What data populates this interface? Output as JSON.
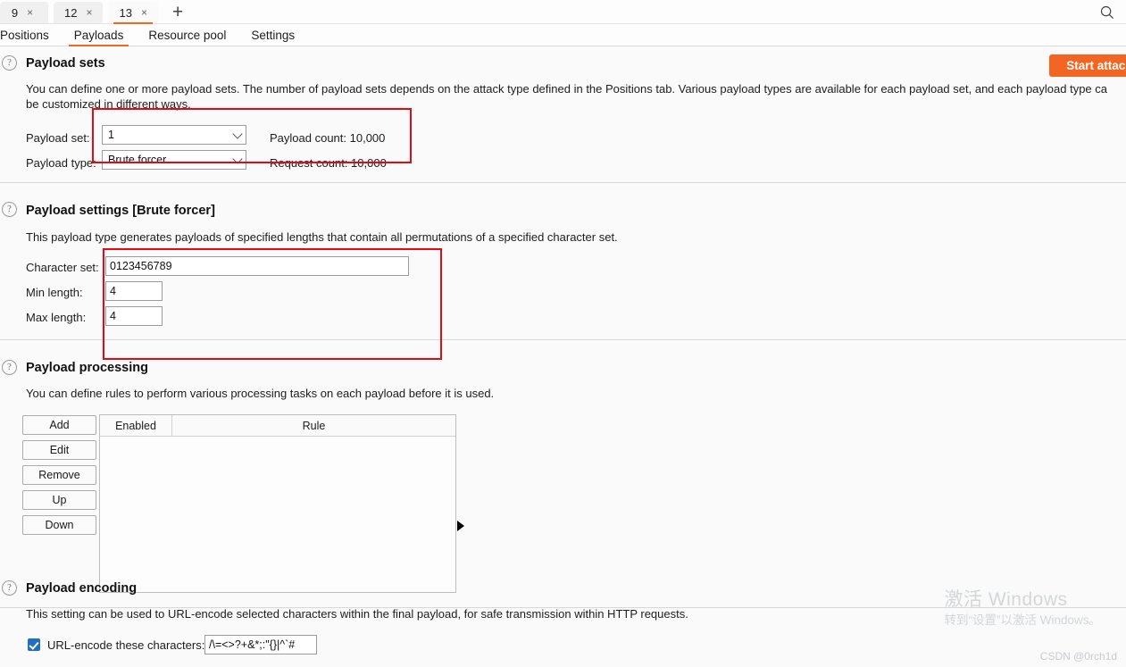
{
  "window": {
    "tabs": [
      {
        "label": "9",
        "close": "×",
        "active": false
      },
      {
        "label": "12",
        "close": "×",
        "active": false
      },
      {
        "label": "13",
        "close": "×",
        "active": true
      }
    ],
    "new_tab_label": "+",
    "search_icon": "search-icon"
  },
  "subnav": {
    "items": [
      {
        "label": "Positions",
        "active": false
      },
      {
        "label": "Payloads",
        "active": true
      },
      {
        "label": "Resource pool",
        "active": false
      },
      {
        "label": "Settings",
        "active": false
      }
    ]
  },
  "toolbar": {
    "start_attack_label": "Start attack",
    "accent_color": "#f26522"
  },
  "payload_sets": {
    "help_icon": "?",
    "title": "Payload sets",
    "description_line1": "You can define one or more payload sets. The number of payload sets depends on the attack type defined in the Positions tab. Various payload types are available for each payload set, and each payload type ca",
    "description_line2": "be customized in different ways.",
    "payload_set_label": "Payload set:",
    "payload_set_value": "1",
    "payload_type_label": "Payload type:",
    "payload_type_value": "Brute forcer",
    "payload_count_label": "Payload count:  10,000",
    "request_count_label": "Request count:  10,000"
  },
  "payload_settings": {
    "help_icon": "?",
    "title": "Payload settings [Brute forcer]",
    "description": "This payload type generates payloads of specified lengths that contain all permutations of a specified character set.",
    "character_set_label": "Character set:",
    "character_set_value": "0123456789",
    "min_length_label": "Min length:",
    "min_length_value": "4",
    "max_length_label": "Max length:",
    "max_length_value": "4"
  },
  "payload_processing": {
    "help_icon": "?",
    "title": "Payload processing",
    "description": "You can define rules to perform various processing tasks on each payload before it is used.",
    "buttons": [
      {
        "label": "Add"
      },
      {
        "label": "Edit"
      },
      {
        "label": "Remove"
      },
      {
        "label": "Up"
      },
      {
        "label": "Down"
      }
    ],
    "table": {
      "columns": [
        "Enabled",
        "Rule"
      ],
      "rows": []
    },
    "expand_icon": "triangle-right-icon"
  },
  "payload_encoding": {
    "help_icon": "?",
    "title": "Payload encoding",
    "description": "This setting can be used to URL-encode selected characters within the final payload, for safe transmission within HTTP requests.",
    "url_encode_checked": true,
    "url_encode_label": "URL-encode these characters:",
    "url_encode_value": "/\\=<>?+&*;:\"{}|^`#"
  },
  "watermark": {
    "line1": "激活 Windows",
    "line2": "转到“设置”以激活 Windows。",
    "credit": "CSDN @0rch1d"
  }
}
